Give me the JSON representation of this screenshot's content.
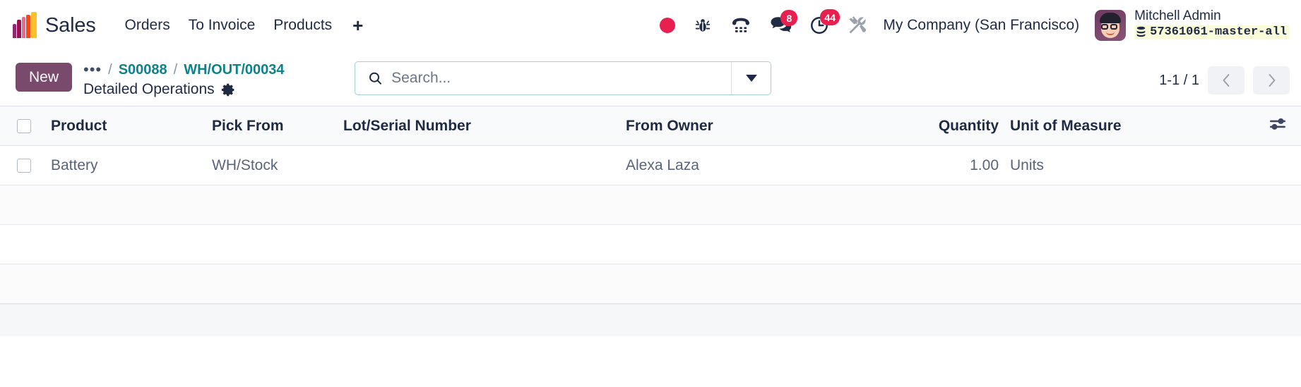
{
  "navbar": {
    "brand": "Sales",
    "logo_icon": "sales-bar-logo-icon",
    "menu": [
      {
        "label": "Orders"
      },
      {
        "label": "To Invoice"
      },
      {
        "label": "Products"
      }
    ],
    "plus_label": "+",
    "system_icons": [
      {
        "name": "record-dot-icon",
        "badge": ""
      },
      {
        "name": "bug-icon",
        "badge": ""
      },
      {
        "name": "phone-dialpad-icon",
        "badge": ""
      },
      {
        "name": "messages-icon",
        "badge": "8"
      },
      {
        "name": "activities-clock-icon",
        "badge": "44"
      },
      {
        "name": "developer-tools-icon",
        "badge": ""
      }
    ],
    "messages_badge": "8",
    "activities_badge": "44",
    "company": "My Company (San Francisco)",
    "user_name": "Mitchell Admin",
    "database": "57361061-master-all",
    "database_icon": "database-stack-icon"
  },
  "control_panel": {
    "new_label": "New",
    "breadcrumb": {
      "dots": "•••",
      "separator": "/",
      "items": [
        {
          "label": "S00088"
        },
        {
          "label": "WH/OUT/00034"
        }
      ]
    },
    "view_title": "Detailed Operations",
    "settings_icon": "gear-icon",
    "search": {
      "placeholder": "Search...",
      "value": "",
      "icon": "search-icon",
      "dropdown_icon": "chevron-down-icon"
    },
    "pager": {
      "label": "1-1 / 1",
      "prev_icon": "chevron-left-icon",
      "next_icon": "chevron-right-icon"
    }
  },
  "table": {
    "columns": [
      {
        "key": "product",
        "label": "Product"
      },
      {
        "key": "pick_from",
        "label": "Pick From"
      },
      {
        "key": "lot_serial",
        "label": "Lot/Serial Number"
      },
      {
        "key": "from_owner",
        "label": "From Owner"
      },
      {
        "key": "quantity",
        "label": "Quantity"
      },
      {
        "key": "unit",
        "label": "Unit of Measure"
      }
    ],
    "optional_columns_icon": "sliders-settings-icon",
    "rows": [
      {
        "product": "Battery",
        "pick_from": "WH/Stock",
        "lot_serial": "",
        "from_owner": "Alexa Laza",
        "quantity": "1.00",
        "unit": "Units"
      }
    ],
    "empty_rows": 3
  },
  "colors": {
    "brand_purple": "#7a4a6d",
    "link_teal": "#0f8289",
    "badge_red": "#e8204f",
    "text_dark": "#1f2b44"
  }
}
